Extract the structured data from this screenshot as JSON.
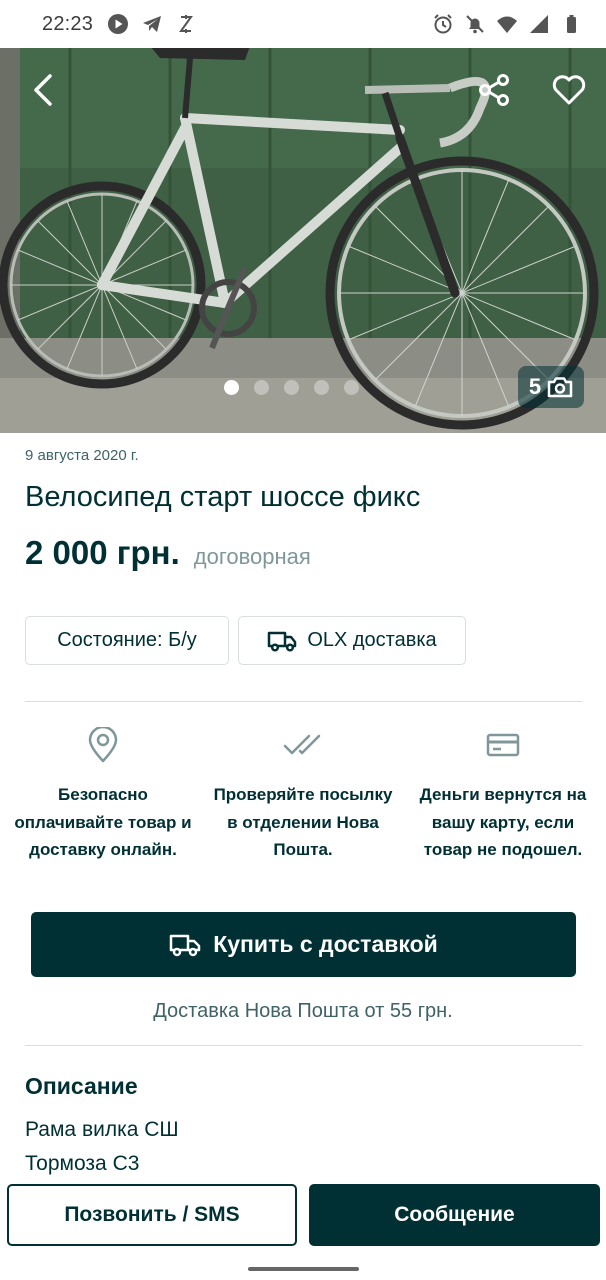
{
  "status_bar": {
    "time": "22:23",
    "left_icons": [
      "play-icon",
      "telegram-icon",
      "charging-icon"
    ],
    "right_icons": [
      "alarm-icon",
      "notifications-off-icon",
      "wifi-icon",
      "signal-icon",
      "battery-icon"
    ]
  },
  "gallery": {
    "photo_count": "5",
    "total_dots": 5,
    "active_dot": 1
  },
  "listing": {
    "date": "9 августа 2020 г.",
    "title": "Велосипед старт шоссе фикс",
    "price": "2 000 грн.",
    "negotiable": "договорная"
  },
  "tags": {
    "condition": "Состояние: Б/у",
    "delivery": "OLX доставка"
  },
  "benefits": [
    {
      "icon": "location-pin-icon",
      "text": "Безопасно оплачивайте товар и доставку онлайн."
    },
    {
      "icon": "double-check-icon",
      "text": "Проверяйте посылку в отделении Нова Пошта."
    },
    {
      "icon": "credit-card-icon",
      "text": "Деньги вернутся на вашу карту, если товар не подошел."
    }
  ],
  "buy": {
    "label": "Купить с доставкой",
    "delivery_note": "Доставка Нова Пошта от 55 грн."
  },
  "description": {
    "heading": "Описание",
    "lines": [
      "Рама вилка СШ",
      "Тормоза С3"
    ]
  },
  "actions": {
    "call_label": "Позвонить / SMS",
    "message_label": "Сообщение"
  },
  "colors": {
    "primary": "#002f34",
    "muted": "#406367",
    "wall_green": "#3e5f43"
  }
}
